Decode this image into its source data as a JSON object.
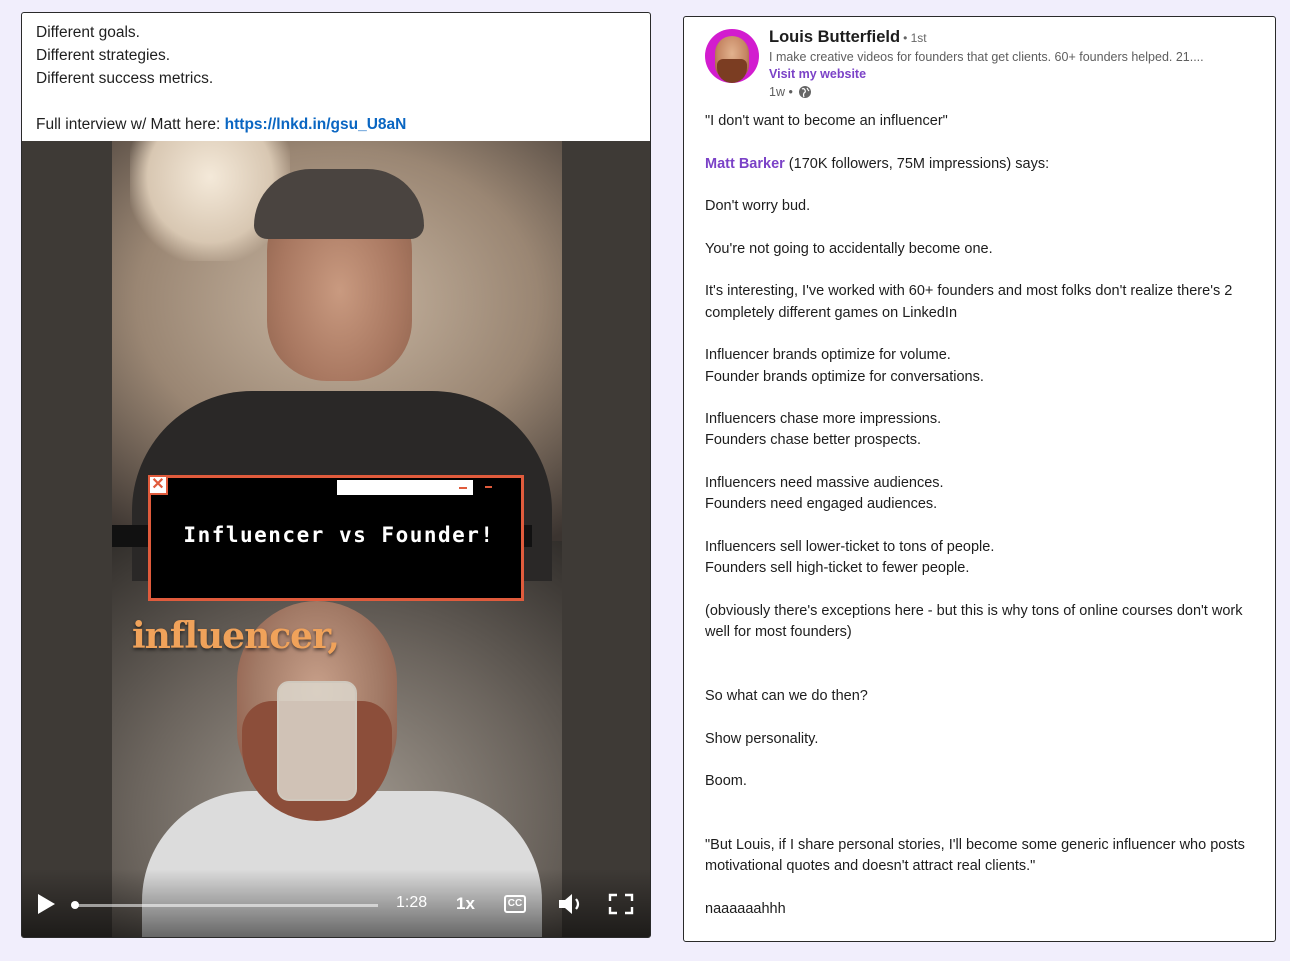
{
  "left_post": {
    "lines": [
      "Different goals.",
      "Different strategies.",
      "Different success metrics."
    ],
    "interview_prefix": "Full interview w/ Matt here: ",
    "interview_link": "https://lnkd.in/gsu_U8aN"
  },
  "video": {
    "overlay_title": "Influencer vs Founder!",
    "close_glyph": "✕",
    "caption_word": "influencer,",
    "time": "1:28",
    "speed": "1x",
    "cc_label": "CC",
    "progress": 0.01
  },
  "right_post": {
    "author": "Louis Butterfield",
    "degree": "• 1st",
    "headline": "I make creative videos for founders that get clients. 60+ founders helped. 21....",
    "website_label": "Visit my website",
    "age": "1w •",
    "p1": "\"I don't want to become an influencer\"",
    "mention": "Matt Barker",
    "mention_rest": " (170K followers, 75M impressions) says:",
    "p3": "Don't worry bud.",
    "p4": "You're not going to accidentally become one.",
    "p5": "It's interesting, I've worked with 60+ founders and most folks don't realize there's 2 completely different games on LinkedIn",
    "p6a": "Influencer brands optimize for volume.",
    "p6b": "Founder brands optimize for conversations.",
    "p7a": "Influencers chase more impressions.",
    "p7b": "Founders chase better prospects.",
    "p8a": "Influencers need massive audiences.",
    "p8b": "Founders need engaged audiences.",
    "p9a": "Influencers sell lower-ticket to tons of people.",
    "p9b": "Founders sell high-ticket to fewer people.",
    "p10": "(obviously there's exceptions here - but this is why tons of online courses don't work well for most founders)",
    "p11": "So what can we do then?",
    "p12": "Show personality.",
    "p13": "Boom.",
    "p14": "\"But Louis, if I share personal stories, I'll become some generic influencer who posts motivational quotes and doesn't attract real clients.\"",
    "p15": "naaaaaahhh"
  },
  "icons": {
    "play": "play-icon",
    "cc": "closed-captions-icon",
    "volume": "volume-icon",
    "fullscreen": "fullscreen-icon",
    "globe": "globe-icon"
  },
  "colors": {
    "background": "#f1eefc",
    "link_blue": "#0a66c2",
    "mention_purple": "#7b42c7",
    "overlay_border": "#e05b3c",
    "caption_orange": "#f0a25a"
  }
}
